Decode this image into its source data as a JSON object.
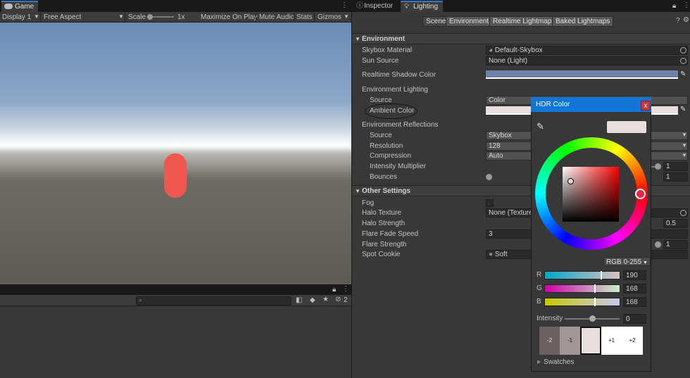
{
  "game": {
    "tab_label": "Game",
    "display": "Display 1",
    "aspect": "Free Aspect",
    "scale_label": "Scale",
    "scale_value": "1x",
    "maximize": "Maximize On Play",
    "mute": "Mute Audio",
    "stats": "Stats",
    "gizmos": "Gizmos",
    "hidden_count": "2"
  },
  "right_tabs": {
    "inspector": "Inspector",
    "lighting": "Lighting"
  },
  "lighting_tabs": [
    "Scene",
    "Environment",
    "Realtime Lightmaps",
    "Baked Lightmaps"
  ],
  "environment": {
    "header": "Environment",
    "skybox_label": "Skybox Material",
    "skybox_value": "Default-Skybox",
    "sun_label": "Sun Source",
    "sun_value": "None (Light)",
    "shadow_label": "Realtime Shadow Color",
    "lighting_label": "Environment Lighting",
    "source_label": "Source",
    "source_value": "Color",
    "ambient_label": "Ambient Color",
    "reflections_label": "Environment Reflections",
    "refl_source_label": "Source",
    "refl_source_value": "Skybox",
    "resolution_label": "Resolution",
    "resolution_value": "128",
    "compression_label": "Compression",
    "compression_value": "Auto",
    "intensity_label": "Intensity Multiplier",
    "intensity_value": "1",
    "bounces_label": "Bounces",
    "bounces_value": "1"
  },
  "other": {
    "header": "Other Settings",
    "fog_label": "Fog",
    "halo_texture_label": "Halo Texture",
    "halo_texture_value": "None (Texture",
    "halo_strength_label": "Halo Strength",
    "halo_strength_value": "0.5",
    "flare_fade_label": "Flare Fade Speed",
    "flare_fade_value": "3",
    "flare_strength_label": "Flare Strength",
    "flare_strength_value": "1",
    "spot_cookie_label": "Spot Cookie",
    "spot_cookie_value": "Soft"
  },
  "hdr": {
    "title": "HDR Color",
    "close": "x",
    "mode": "RGB 0-255",
    "r_label": "R",
    "r_value": "190",
    "g_label": "G",
    "g_value": "168",
    "b_label": "B",
    "b_value": "168",
    "intensity_label": "Intensity",
    "intensity_value": "0",
    "swatches": [
      "-2",
      "-1",
      "",
      "+1",
      "+2"
    ],
    "swatches_label": "Swatches"
  },
  "colors": {
    "capsule": "#ef574f",
    "shadow_color": "#6d81a9",
    "ambient_color": "#bea8a8",
    "accent": "#0f76d8"
  }
}
